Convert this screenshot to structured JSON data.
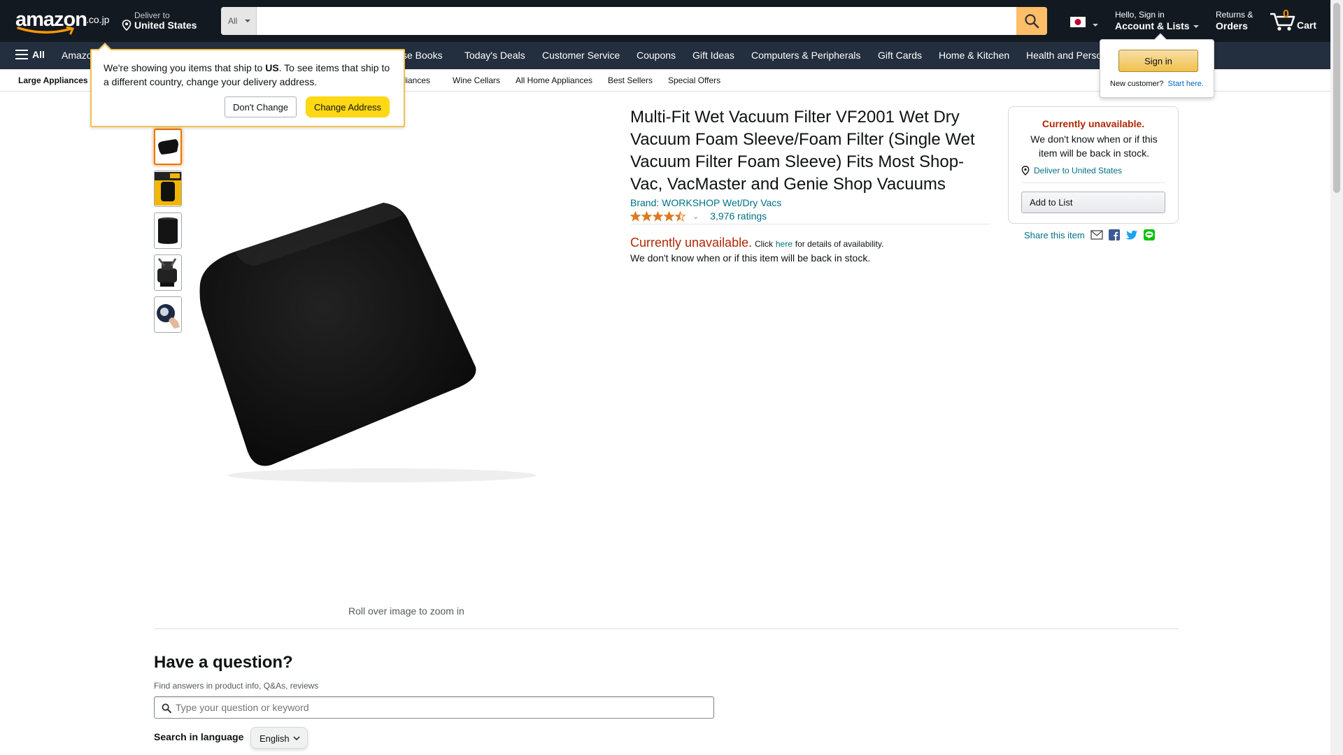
{
  "header": {
    "logo_text": "amazon",
    "logo_tld": ".co.jp",
    "deliver_line1": "Deliver to",
    "deliver_line2": "United States",
    "search_scope": "All",
    "search_placeholder": "",
    "account_line1": "Hello, Sign in",
    "account_line2": "Account & Lists",
    "returns_line1": "Returns &",
    "returns_line2": "Orders",
    "cart_count": "0",
    "cart_label": "Cart"
  },
  "main_nav": {
    "all_label": "All",
    "items": [
      "Amazo",
      "se Books",
      "Today's Deals",
      "Customer Service",
      "Coupons",
      "Gift Ideas",
      "Computers & Peripherals",
      "Gift Cards",
      "Home & Kitchen",
      "Health and Perso"
    ]
  },
  "sub_nav": {
    "items": [
      "Large Appliances",
      "pliances",
      "Wine Cellars",
      "All Home Appliances",
      "Best Sellers",
      "Special Offers"
    ]
  },
  "delivery_popover": {
    "msg_a": "We're showing you items that ship to ",
    "msg_bold": "US",
    "msg_b": ". To see items that ship to a different country, change your delivery address.",
    "dont_change": "Don't Change",
    "change_address": "Change Address"
  },
  "signin_popover": {
    "button": "Sign in",
    "new_customer": "New customer?",
    "start_here": "Start here."
  },
  "product": {
    "title": "Multi-Fit Wet Vacuum Filter VF2001 Wet Dry Vacuum Foam Sleeve/Foam Filter (Single Wet Vacuum Filter Foam Sleeve) Fits Most Shop-Vac, VacMaster and Genie Shop Vacuums",
    "brand": "Brand: WORKSHOP Wet/Dry Vacs",
    "rating_value": 4.5,
    "ratings_count": "3,976 ratings",
    "unavailable": "Currently unavailable.",
    "click": "Click",
    "here": "here",
    "details": "for details of availability.",
    "back_in_stock": "We don't know when or if this item will be back in stock.",
    "zoom_hint": "Roll over image to zoom in",
    "thumbnails": [
      "foam-sleeve",
      "package",
      "cylinder-filter",
      "shop-vac",
      "hand-holding"
    ]
  },
  "buybox": {
    "heading": "Currently unavailable.",
    "text": "We don't know when or if this item will be back in stock.",
    "deliver": "Deliver to United States",
    "add_to_list": "Add to List"
  },
  "share": {
    "label": "Share this item"
  },
  "question": {
    "title": "Have a question?",
    "subtitle": "Find answers in product info, Q&As, reviews",
    "placeholder": "Type your question or keyword",
    "lang_label": "Search in language",
    "lang_value": "English"
  },
  "colors": {
    "nav_dark": "#131921",
    "nav_main": "#232f3e",
    "accent": "#febd69",
    "link": "#007185",
    "price_red": "#b12704",
    "button_yellow": "#ffd814"
  }
}
